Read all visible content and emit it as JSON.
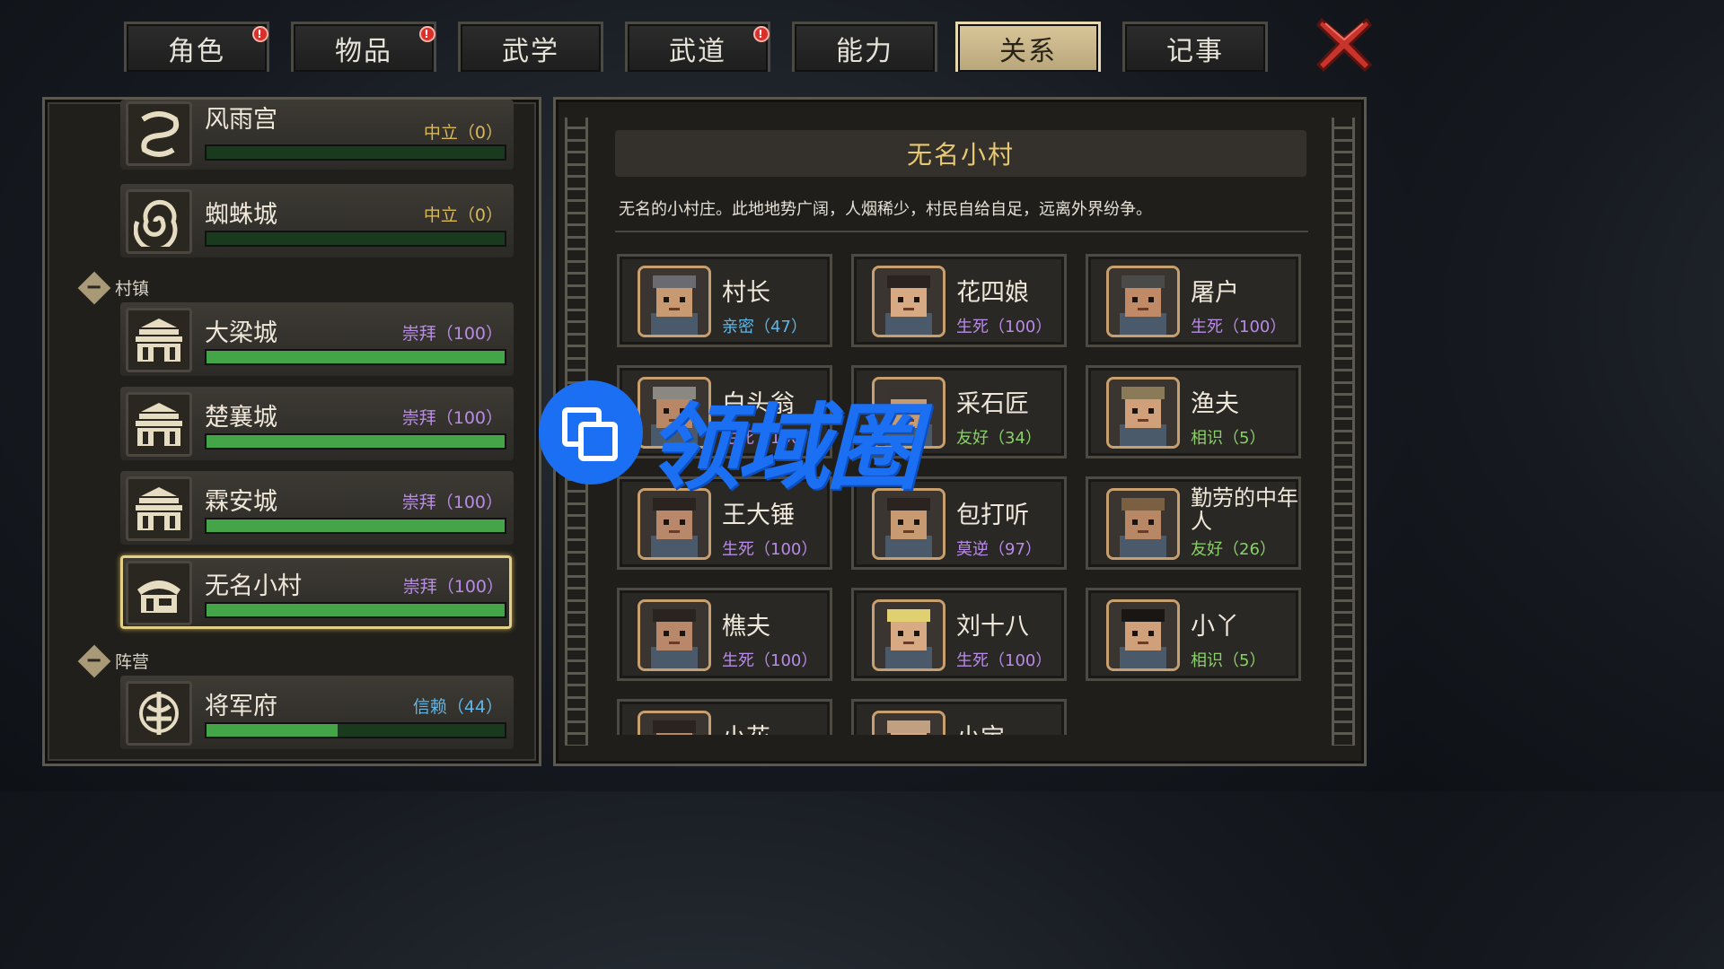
{
  "tabs": [
    {
      "label": "角色",
      "alert": true,
      "active": false
    },
    {
      "label": "物品",
      "alert": true,
      "active": false
    },
    {
      "label": "武学",
      "alert": false,
      "active": false
    },
    {
      "label": "武道",
      "alert": true,
      "active": false
    },
    {
      "label": "能力",
      "alert": false,
      "active": false
    },
    {
      "label": "关系",
      "alert": false,
      "active": true
    },
    {
      "label": "记事",
      "alert": false,
      "active": false
    }
  ],
  "alert_mark": "!",
  "colors": {
    "neutral": "#d9b85a",
    "worship": "#b98be8",
    "trust": "#5fb6e8",
    "intimate": "#5fb6e8",
    "lifedeath": "#b98be8",
    "friendly": "#8ad06a",
    "acquaint": "#8ad06a",
    "hostile": "#b98be8",
    "bar_fill": "#43a548",
    "title_gold": "#e8c870",
    "close_red": "#c8342c"
  },
  "left": {
    "factions_top": [
      {
        "name": "风雨宫",
        "status": "中立（0）",
        "status_color": "neutral",
        "progress": 1.0,
        "icon": "snake-emblem-icon"
      },
      {
        "name": "蜘蛛城",
        "status": "中立（0）",
        "status_color": "neutral",
        "progress": 1.0,
        "icon": "spiral-emblem-icon"
      }
    ],
    "section_village": "村镇",
    "villages": [
      {
        "name": "大梁城",
        "status": "崇拜（100）",
        "status_color": "worship",
        "progress": 1.0,
        "icon": "palace-icon"
      },
      {
        "name": "楚襄城",
        "status": "崇拜（100）",
        "status_color": "worship",
        "progress": 1.0,
        "icon": "palace-icon"
      },
      {
        "name": "霖安城",
        "status": "崇拜（100）",
        "status_color": "worship",
        "progress": 1.0,
        "icon": "palace-icon"
      },
      {
        "name": "无名小村",
        "status": "崇拜（100）",
        "status_color": "worship",
        "progress": 1.0,
        "icon": "hut-icon",
        "selected": true
      }
    ],
    "section_camp": "阵营",
    "camps": [
      {
        "name": "将军府",
        "status": "信赖（44）",
        "status_color": "trust",
        "progress": 0.44,
        "icon": "trident-emblem-icon"
      }
    ]
  },
  "right": {
    "title": "无名小村",
    "description": "无名的小村庄。此地地势广阔，人烟稀少，村民自给自足，远离外界纷争。",
    "npcs": [
      {
        "name": "村长",
        "rel": "亲密（47）",
        "rel_color": "intimate"
      },
      {
        "name": "花四娘",
        "rel": "生死（100）",
        "rel_color": "lifedeath"
      },
      {
        "name": "屠户",
        "rel": "生死（100）",
        "rel_color": "lifedeath"
      },
      {
        "name": "白头翁",
        "rel": "生死（100）",
        "rel_color": "lifedeath"
      },
      {
        "name": "采石匠",
        "rel": "友好（34）",
        "rel_color": "friendly"
      },
      {
        "name": "渔夫",
        "rel": "相识（5）",
        "rel_color": "acquaint"
      },
      {
        "name": "王大锤",
        "rel": "生死（100）",
        "rel_color": "lifedeath"
      },
      {
        "name": "包打听",
        "rel": "莫逆（97）",
        "rel_color": "hostile"
      },
      {
        "name": "勤劳的中年人",
        "rel": "友好（26）",
        "rel_color": "friendly"
      },
      {
        "name": "樵夫",
        "rel": "生死（100）",
        "rel_color": "lifedeath"
      },
      {
        "name": "刘十八",
        "rel": "生死（100）",
        "rel_color": "lifedeath"
      },
      {
        "name": "小丫",
        "rel": "相识（5）",
        "rel_color": "acquaint"
      },
      {
        "name": "小花",
        "rel": "",
        "rel_color": "acquaint"
      },
      {
        "name": "小宝",
        "rel": "",
        "rel_color": "acquaint"
      }
    ]
  },
  "watermark": {
    "text": "领域圈"
  }
}
